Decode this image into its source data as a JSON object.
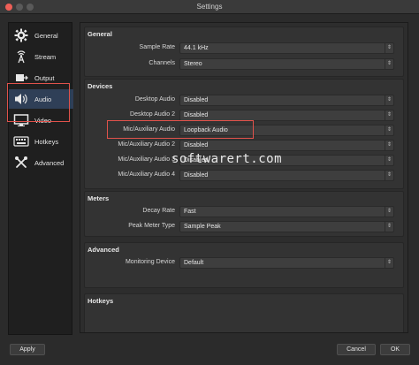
{
  "window": {
    "title": "Settings"
  },
  "sidebar": {
    "items": [
      {
        "label": "General",
        "icon": "gear-icon"
      },
      {
        "label": "Stream",
        "icon": "antenna-icon"
      },
      {
        "label": "Output",
        "icon": "output-icon"
      },
      {
        "label": "Audio",
        "icon": "speaker-icon",
        "active": true
      },
      {
        "label": "Video",
        "icon": "monitor-icon"
      },
      {
        "label": "Hotkeys",
        "icon": "keyboard-icon"
      },
      {
        "label": "Advanced",
        "icon": "tools-icon"
      }
    ]
  },
  "general": {
    "title": "General",
    "sample_rate": {
      "label": "Sample Rate",
      "value": "44.1 kHz"
    },
    "channels": {
      "label": "Channels",
      "value": "Stereo"
    }
  },
  "devices": {
    "title": "Devices",
    "rows": [
      {
        "label": "Desktop Audio",
        "value": "Disabled"
      },
      {
        "label": "Desktop Audio 2",
        "value": "Disabled"
      },
      {
        "label": "Mic/Auxiliary Audio",
        "value": "Loopback Audio"
      },
      {
        "label": "Mic/Auxiliary Audio 2",
        "value": "Disabled"
      },
      {
        "label": "Mic/Auxiliary Audio 3",
        "value": "Disabled"
      },
      {
        "label": "Mic/Auxiliary Audio 4",
        "value": "Disabled"
      }
    ]
  },
  "meters": {
    "title": "Meters",
    "decay": {
      "label": "Decay Rate",
      "value": "Fast"
    },
    "peak": {
      "label": "Peak Meter Type",
      "value": "Sample Peak"
    }
  },
  "advanced": {
    "title": "Advanced",
    "monitoring": {
      "label": "Monitoring Device",
      "value": "Default"
    }
  },
  "hotkeys": {
    "title": "Hotkeys"
  },
  "watermark": "softwarert.com",
  "buttons": {
    "apply": "Apply",
    "cancel": "Cancel",
    "ok": "OK"
  },
  "colors": {
    "highlight": "#e0524b",
    "active_nav": "#2f3f57",
    "close_light": "#ee5f57"
  }
}
